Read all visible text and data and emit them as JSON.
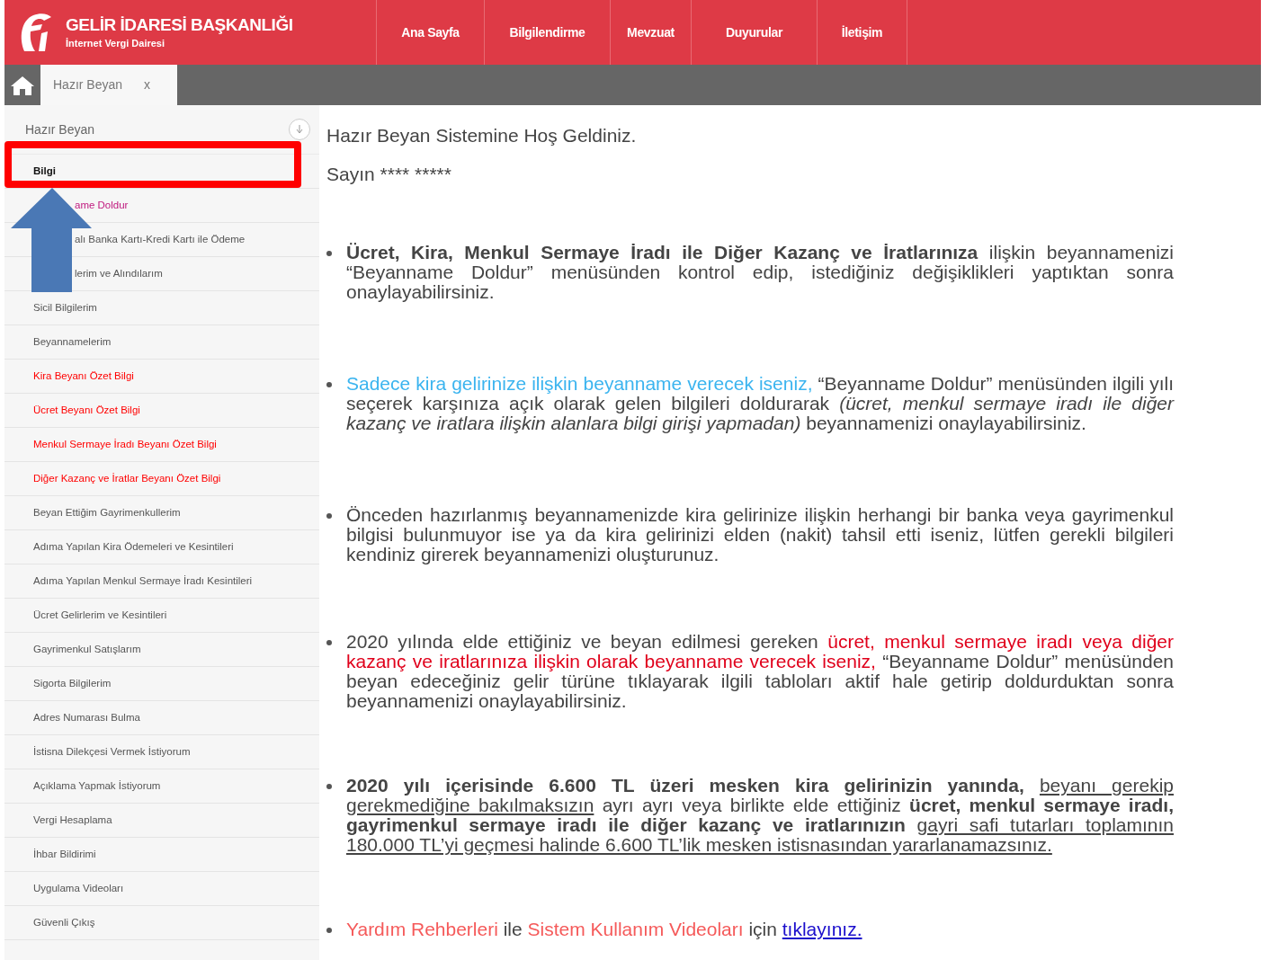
{
  "header": {
    "title": "GELİR İDARESİ BAŞKANLIĞI",
    "subtitle": "İnternet Vergi Dairesi",
    "nav": [
      "Ana Sayfa",
      "Bilgilendirme",
      "Mevzuat",
      "Duyurular",
      "İletişim"
    ]
  },
  "tabs": [
    {
      "label": "Hazır Beyan",
      "close": "x",
      "selected": true
    }
  ],
  "sidebar": {
    "title": "Hazır Beyan",
    "items": [
      {
        "label": "Bilgi",
        "selected": true,
        "kind": "full",
        "color": "#111111"
      },
      {
        "label": "ame Doldur",
        "selected": false,
        "kind": "partial",
        "color": "#c0197e"
      },
      {
        "label": "alı Banka Kartı-Kredi Kartı ile Ödeme",
        "selected": false,
        "kind": "partial",
        "color": "#555555"
      },
      {
        "label": "lerim ve Alındılarım",
        "selected": false,
        "kind": "partial",
        "color": "#555555"
      },
      {
        "label": "Sicil Bilgilerim",
        "selected": false,
        "kind": "full",
        "color": "#555555"
      },
      {
        "label": "Beyannamelerim",
        "selected": false,
        "kind": "full",
        "color": "#555555"
      },
      {
        "label": "Kira Beyanı Özet Bilgi",
        "selected": false,
        "kind": "full",
        "color": "#ff0000"
      },
      {
        "label": "Ücret Beyanı Özet Bilgi",
        "selected": false,
        "kind": "full",
        "color": "#ff0000"
      },
      {
        "label": "Menkul Sermaye İradı Beyanı Özet Bilgi",
        "selected": false,
        "kind": "full",
        "color": "#ff0000"
      },
      {
        "label": "Diğer Kazanç ve İratlar Beyanı Özet Bilgi",
        "selected": false,
        "kind": "full",
        "color": "#ff0000"
      },
      {
        "label": "Beyan Ettiğim Gayrimenkullerim",
        "selected": false,
        "kind": "full",
        "color": "#555555"
      },
      {
        "label": "Adıma Yapılan Kira Ödemeleri ve Kesintileri",
        "selected": false,
        "kind": "full",
        "color": "#555555"
      },
      {
        "label": "Adıma Yapılan Menkul Sermaye İradı Kesintileri",
        "selected": false,
        "kind": "full",
        "color": "#555555"
      },
      {
        "label": "Ücret Gelirlerim ve Kesintileri",
        "selected": false,
        "kind": "full",
        "color": "#555555"
      },
      {
        "label": "Gayrimenkul Satışlarım",
        "selected": false,
        "kind": "full",
        "color": "#555555"
      },
      {
        "label": "Sigorta Bilgilerim",
        "selected": false,
        "kind": "full",
        "color": "#555555"
      },
      {
        "label": "Adres Numarası Bulma",
        "selected": false,
        "kind": "full",
        "color": "#555555"
      },
      {
        "label": "İstisna Dilekçesi Vermek İstiyorum",
        "selected": false,
        "kind": "full",
        "color": "#555555"
      },
      {
        "label": "Açıklama Yapmak İstiyorum",
        "selected": false,
        "kind": "full",
        "color": "#555555"
      },
      {
        "label": "Vergi Hesaplama",
        "selected": false,
        "kind": "full",
        "color": "#555555"
      },
      {
        "label": "İhbar Bildirimi",
        "selected": false,
        "kind": "full",
        "color": "#555555"
      },
      {
        "label": "Uygulama Videoları",
        "selected": false,
        "kind": "full",
        "color": "#555555"
      },
      {
        "label": "Güvenli Çıkış",
        "selected": false,
        "kind": "full",
        "color": "#555555"
      }
    ]
  },
  "content": {
    "welcome": "Hazır Beyan Sistemine Hoş Geldiniz.",
    "greeting": "Sayın **** *****",
    "bullets": [
      [
        {
          "kind": "bold",
          "text": "Ücret, Kira, Menkul Sermaye İradı ile Diğer Kazanç ve İratlarınıza"
        },
        {
          "kind": "plain",
          "text": " ilişkin beyannamenizi “Beyanname Doldur” menüsünden kontrol edip, istediğiniz değişiklikleri yaptıktan sonra onaylayabilirsiniz."
        }
      ],
      [
        {
          "kind": "blue",
          "text": "Sadece kira gelirinize ilişkin beyanname verecek iseniz,"
        },
        {
          "kind": "plain",
          "text": " “Beyanname Doldur” menüsünden ilgili yılı seçerek karşınıza açık olarak gelen bilgileri doldurarak "
        },
        {
          "kind": "italic",
          "text": "(ücret, menkul sermaye iradı ile diğer kazanç ve iratlara ilişkin alanlara bilgi girişi yapmadan)"
        },
        {
          "kind": "plain",
          "text": " beyannamenizi onaylayabilirsiniz."
        }
      ],
      [
        {
          "kind": "plain",
          "text": "Önceden hazırlanmış beyannamenizde kira gelirinize ilişkin herhangi bir banka veya gayrimenkul bilgisi bulunmuyor ise ya da kira gelirinizi elden (nakit) tahsil etti iseniz, lütfen gerekli bilgileri kendiniz girerek beyannamenizi oluşturunuz."
        }
      ],
      [
        {
          "kind": "plain",
          "text": "2020 yılında elde ettiğiniz ve beyan edilmesi gereken "
        },
        {
          "kind": "red",
          "text": "ücret, menkul sermaye iradı veya diğer kazanç ve iratlarınıza ilişkin olarak beyanname verecek iseniz,"
        },
        {
          "kind": "plain",
          "text": " “Beyanname Doldur” menüsünden beyan edeceğiniz gelir türüne tıklayarak ilgili tabloları aktif hale getirip doldurduktan sonra beyannamenizi onaylayabilirsiniz."
        }
      ],
      [
        {
          "kind": "bold",
          "text": "2020 yılı içerisinde 6.600 TL üzeri mesken kira gelirinizin yanında, "
        },
        {
          "kind": "underline",
          "text": "beyanı gerekip gerekmediğine bakılmaksızın"
        },
        {
          "kind": "plain",
          "text": " ayrı ayrı veya birlikte elde ettiğiniz "
        },
        {
          "kind": "bold",
          "text": "ücret, menkul sermaye iradı, gayrimenkul sermaye iradı ile diğer kazanç ve iratlarınızın "
        },
        {
          "kind": "underline",
          "text": "gayri safi tutarları toplamının 180.000 TL’yi geçmesi halinde 6.600 TL’lik mesken istisnasından yararlanamazsınız."
        }
      ],
      [
        {
          "kind": "pink",
          "text": "Yardım Rehberleri"
        },
        {
          "kind": "plain",
          "text": " ile "
        },
        {
          "kind": "pink",
          "text": "Sistem Kullanım Videoları"
        },
        {
          "kind": "plain",
          "text": " için "
        },
        {
          "kind": "link",
          "text": "tıklayınız."
        }
      ]
    ]
  }
}
